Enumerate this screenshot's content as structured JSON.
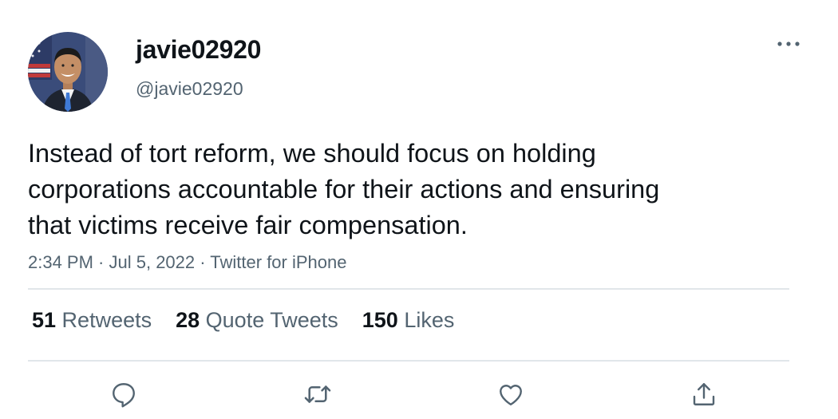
{
  "user": {
    "display_name": "javie02920",
    "handle": "@javie02920"
  },
  "tweet": {
    "text": "Instead of tort reform, we should focus on holding corporations accountable for their actions and ensuring that victims receive fair compensation.",
    "time": "2:34 PM",
    "date": "Jul 5, 2022",
    "source": "Twitter for iPhone",
    "separator": " · "
  },
  "stats": {
    "retweets_count": "51",
    "retweets_label": " Retweets",
    "quotes_count": "28",
    "quotes_label": " Quote Tweets",
    "likes_count": "150",
    "likes_label": " Likes"
  },
  "icons": {
    "more": "more-dots-icon",
    "reply": "reply-icon",
    "retweet": "retweet-icon",
    "like": "heart-icon",
    "share": "share-icon"
  },
  "colors": {
    "text": "#0f1419",
    "secondary": "#536471",
    "divider": "#e1e6ea"
  }
}
